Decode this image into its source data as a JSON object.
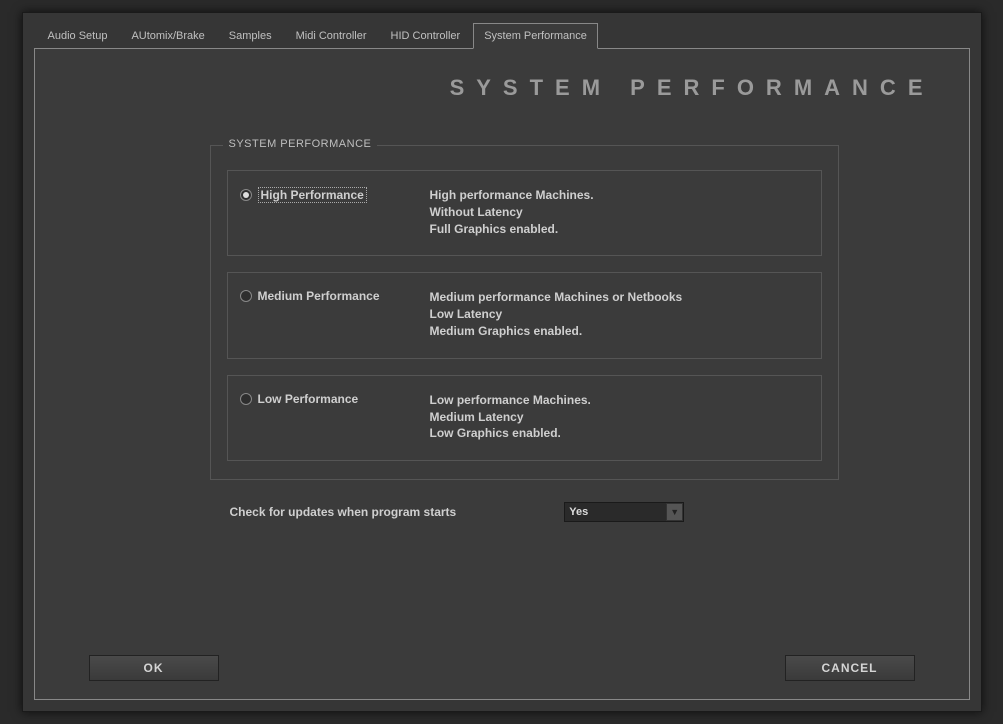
{
  "tabs": [
    {
      "label": "Audio Setup",
      "active": false
    },
    {
      "label": "AUtomix/Brake",
      "active": false
    },
    {
      "label": "Samples",
      "active": false
    },
    {
      "label": "Midi Controller",
      "active": false
    },
    {
      "label": "HID Controller",
      "active": false
    },
    {
      "label": "System Performance",
      "active": true
    }
  ],
  "page_title": "SYSTEM PERFORMANCE",
  "group_label": "SYSTEM PERFORMANCE",
  "options": [
    {
      "id": "high",
      "label": "High Performance",
      "selected": true,
      "desc": "High performance Machines.\nWithout Latency\nFull Graphics enabled."
    },
    {
      "id": "medium",
      "label": "Medium Performance",
      "selected": false,
      "desc": "Medium performance Machines or Netbooks\nLow Latency\nMedium Graphics enabled."
    },
    {
      "id": "low",
      "label": "Low Performance",
      "selected": false,
      "desc": "Low performance Machines.\nMedium Latency\nLow Graphics enabled."
    }
  ],
  "update_check": {
    "label": "Check for updates when program starts",
    "value": "Yes"
  },
  "buttons": {
    "ok": "OK",
    "cancel": "CANCEL"
  }
}
